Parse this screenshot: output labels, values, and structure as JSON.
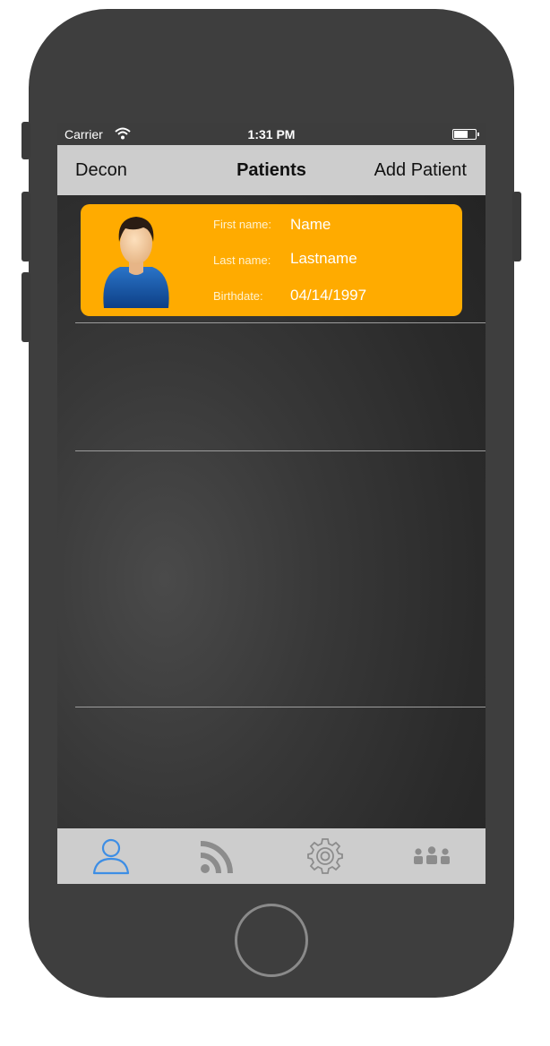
{
  "status_bar": {
    "carrier": "Carrier",
    "time": "1:31 PM",
    "wifi_icon": "wifi-icon",
    "battery_icon": "battery-icon"
  },
  "nav_bar": {
    "left_label": "Decon",
    "title": "Patients",
    "right_label": "Add Patient"
  },
  "patients": [
    {
      "first_name_label": "First name:",
      "first_name": "Name",
      "last_name_label": "Last name:",
      "last_name": "Lastname",
      "birthdate_label": "Birthdate:",
      "birthdate": "04/14/1997",
      "avatar_icon": "male-avatar-icon"
    }
  ],
  "tab_bar": {
    "items": [
      {
        "icon": "person-icon",
        "selected": true
      },
      {
        "icon": "rss-feed-icon",
        "selected": false
      },
      {
        "icon": "gear-icon",
        "selected": false
      },
      {
        "icon": "group-icon",
        "selected": false
      }
    ]
  },
  "colors": {
    "card_background": "#ffab00",
    "bar_background": "#cdcdcd",
    "tab_selected": "#3d8ee5",
    "tab_unselected": "#8c8c8c",
    "device_body": "#3e3e3e"
  }
}
